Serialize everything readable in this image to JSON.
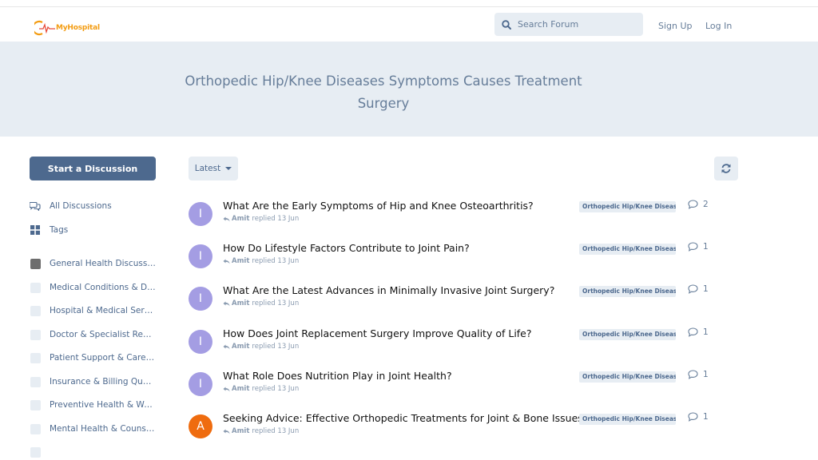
{
  "header": {
    "logo_text": "MyHospital",
    "search_placeholder": "Search Forum",
    "signup_label": "Sign Up",
    "login_label": "Log In"
  },
  "hero": {
    "title_line1": "Orthopedic Hip/Knee Diseases Symptoms Causes Treatment",
    "title_line2": "Surgery"
  },
  "sidebar": {
    "start_label": "Start a Discussion",
    "nav": [
      {
        "label": "All Discussions",
        "icon": "comments-icon"
      },
      {
        "label": "Tags",
        "icon": "grid-icon"
      }
    ],
    "categories": [
      {
        "label": "General Health Discussions",
        "swatch": "#6d6d6d"
      },
      {
        "label": "Medical Conditions & Dis...",
        "swatch": "#e7edf3"
      },
      {
        "label": "Hospital & Medical Services",
        "swatch": "#e7edf3"
      },
      {
        "label": "Doctor & Specialist Reviews",
        "swatch": "#e7edf3"
      },
      {
        "label": "Patient Support & Caregiv...",
        "swatch": "#e7edf3"
      },
      {
        "label": "Insurance & Billing Questi...",
        "swatch": "#e7edf3"
      },
      {
        "label": "Preventive Health & Welln...",
        "swatch": "#e7edf3"
      },
      {
        "label": "Mental Health & Counseli...",
        "swatch": "#e7edf3"
      }
    ]
  },
  "toolbar": {
    "sort_label": "Latest"
  },
  "discussions": [
    {
      "avatar": "I",
      "avatar_color": "#a49de3",
      "title": "What Are the Early Symptoms of Hip and Knee Osteoarthritis?",
      "user": "Amit",
      "action": "replied",
      "date": "13 Jun",
      "tag": "Orthopedic Hip/Knee Diseases",
      "replies": "2"
    },
    {
      "avatar": "I",
      "avatar_color": "#a49de3",
      "title": "How Do Lifestyle Factors Contribute to Joint Pain?",
      "user": "Amit",
      "action": "replied",
      "date": "13 Jun",
      "tag": "Orthopedic Hip/Knee Diseases",
      "replies": "1"
    },
    {
      "avatar": "I",
      "avatar_color": "#a49de3",
      "title": "What Are the Latest Advances in Minimally Invasive Joint Surgery?",
      "user": "Amit",
      "action": "replied",
      "date": "13 Jun",
      "tag": "Orthopedic Hip/Knee Diseases",
      "replies": "1"
    },
    {
      "avatar": "I",
      "avatar_color": "#a49de3",
      "title": "How Does Joint Replacement Surgery Improve Quality of Life?",
      "user": "Amit",
      "action": "replied",
      "date": "13 Jun",
      "tag": "Orthopedic Hip/Knee Diseases",
      "replies": "1"
    },
    {
      "avatar": "I",
      "avatar_color": "#a49de3",
      "title": "What Role Does Nutrition Play in Joint Health?",
      "user": "Amit",
      "action": "replied",
      "date": "13 Jun",
      "tag": "Orthopedic Hip/Knee Diseases",
      "replies": "1"
    },
    {
      "avatar": "A",
      "avatar_color": "#ef6c0f",
      "title": "Seeking Advice: Effective Orthopedic Treatments for Joint & Bone Issues",
      "user": "Amit",
      "action": "replied",
      "date": "13 Jun",
      "tag": "Orthopedic Hip/Knee Diseases",
      "replies": "1"
    }
  ]
}
